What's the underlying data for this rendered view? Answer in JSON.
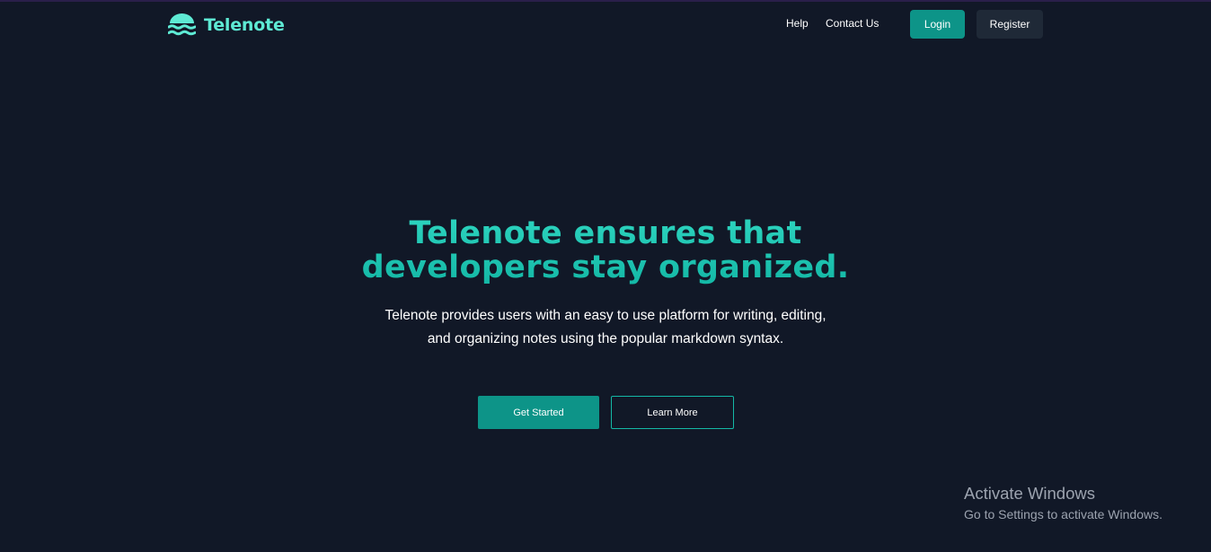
{
  "brand": {
    "name": "Telenote",
    "logo_icon": "waves-logo-icon",
    "color": "#5eead4"
  },
  "nav": {
    "links": [
      {
        "label": "Help"
      },
      {
        "label": "Contact Us"
      }
    ],
    "login_label": "Login",
    "register_label": "Register"
  },
  "hero": {
    "title_line1": "Telenote ensures that",
    "title_line2": "developers stay organized.",
    "subtitle": "Telenote provides users with an easy to use platform for writing, editing, and organizing notes using the popular markdown syntax.",
    "primary_cta": "Get Started",
    "secondary_cta": "Learn More"
  },
  "watermark": {
    "title": "Activate Windows",
    "subtitle": "Go to Settings to activate Windows."
  },
  "colors": {
    "background": "#111827",
    "accent": "#0d9488",
    "accent_light": "#2dd4bf",
    "secondary_button": "#1f2937"
  }
}
